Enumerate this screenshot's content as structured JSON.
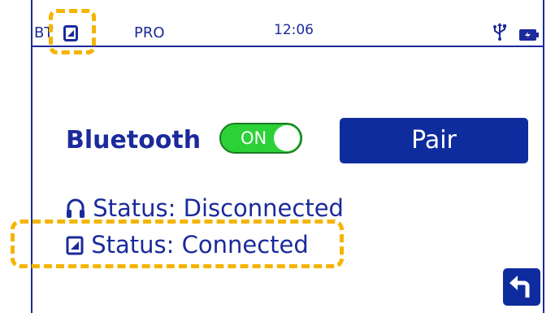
{
  "status_bar": {
    "bt_label": "BT",
    "mode": "PRO",
    "time": "12:06",
    "icons": [
      "phone-icon",
      "usb-icon",
      "battery-icon"
    ]
  },
  "bluetooth": {
    "label": "Bluetooth",
    "toggle_state": "ON",
    "toggle_color": "#2bd136"
  },
  "pair_button": {
    "label": "Pair"
  },
  "status_rows": [
    {
      "icon": "headphones-icon",
      "text": "Status: Disconnected"
    },
    {
      "icon": "phone-icon",
      "text": "Status: Connected"
    }
  ],
  "back_button": {
    "icon": "back-arrow-icon"
  },
  "colors": {
    "primary": "#1b2a9c",
    "button": "#0f2c9e",
    "highlight": "#f5b400",
    "toggle_on": "#2bd136"
  }
}
